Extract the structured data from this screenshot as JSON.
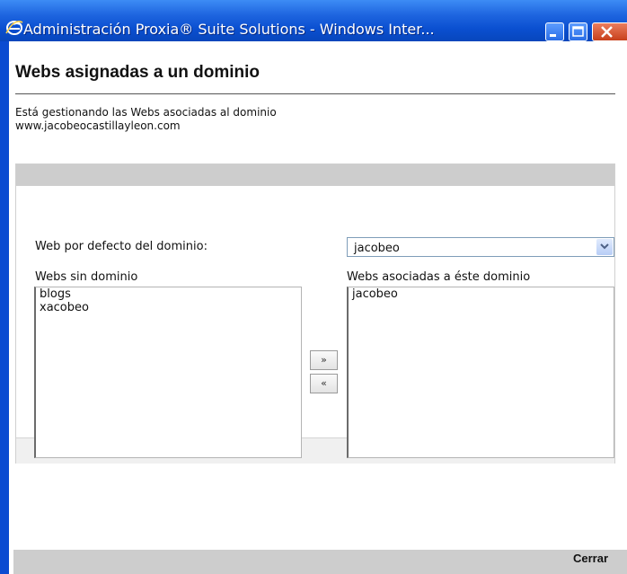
{
  "window": {
    "title": "Administración Proxia® Suite Solutions - Windows Inter..."
  },
  "page": {
    "title": "Webs asignadas a un dominio",
    "description_line1": "Está gestionando las Webs asociadas al dominio",
    "description_line2": "www.jacobeocastillayleon.com"
  },
  "default_web": {
    "label": "Web por defecto del dominio:",
    "selected": "jacobeo"
  },
  "webs_sin_dominio": {
    "label": "Webs sin dominio",
    "items": [
      "blogs",
      "xacobeo"
    ]
  },
  "webs_asociadas": {
    "label": "Webs asociadas a éste dominio",
    "items": [
      "jacobeo"
    ]
  },
  "buttons": {
    "add": "»",
    "remove": "«",
    "close": "Cerrar"
  },
  "icons": {
    "app": "internet-explorer-icon",
    "minimize": "minimize-icon",
    "maximize": "maximize-icon",
    "close": "close-icon",
    "dropdown": "chevron-down-icon"
  },
  "colors": {
    "titlebar": "#0a4fd0",
    "panel_header": "#cdcdcd",
    "close_button": "#c8401b"
  }
}
